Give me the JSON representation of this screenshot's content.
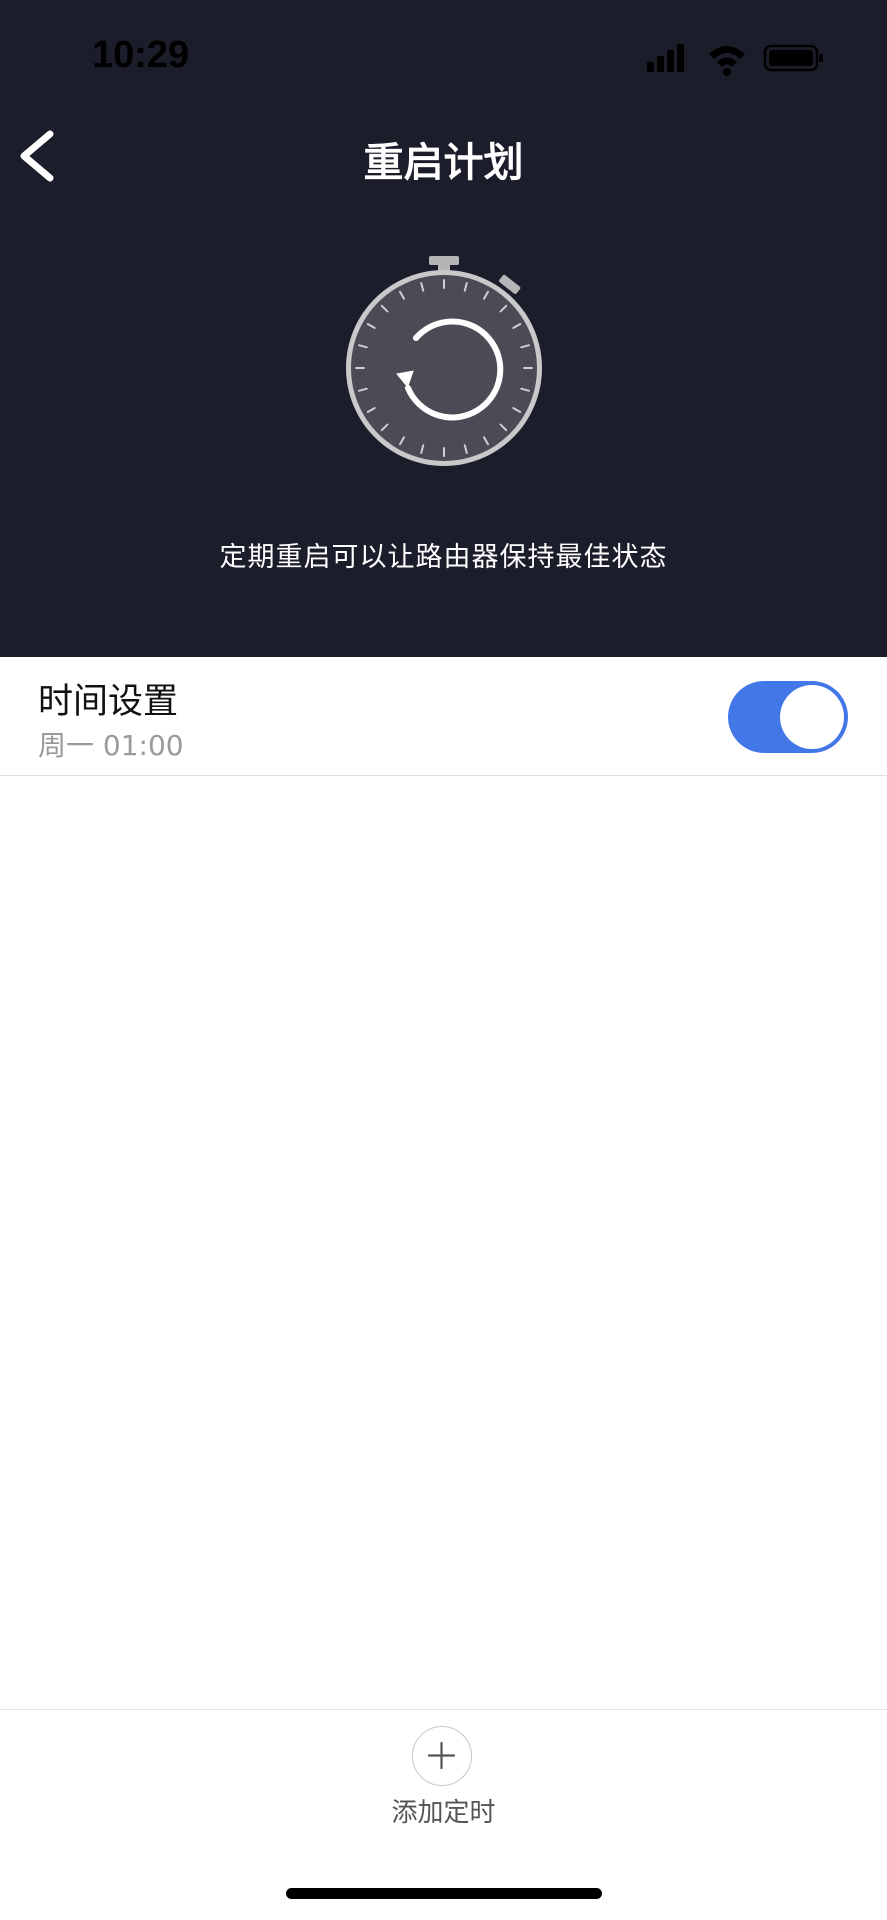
{
  "status_bar": {
    "time": "10:29",
    "signal_icon": "cellular-signal-icon",
    "wifi_icon": "wifi-icon",
    "battery_icon": "battery-icon"
  },
  "nav": {
    "back_icon": "chevron-left-icon",
    "title": "重启计划"
  },
  "hero": {
    "illustration_icon": "stopwatch-restart-icon",
    "subtitle": "定期重启可以让路由器保持最佳状态"
  },
  "schedule": {
    "title": "时间设置",
    "value": "周一 01:00",
    "enabled": true
  },
  "footer": {
    "add_icon": "plus-icon",
    "add_label": "添加定时"
  },
  "colors": {
    "header_bg": "#1c1d2b",
    "toggle_on": "#4277e8",
    "secondary_text": "#9a9a9a"
  }
}
